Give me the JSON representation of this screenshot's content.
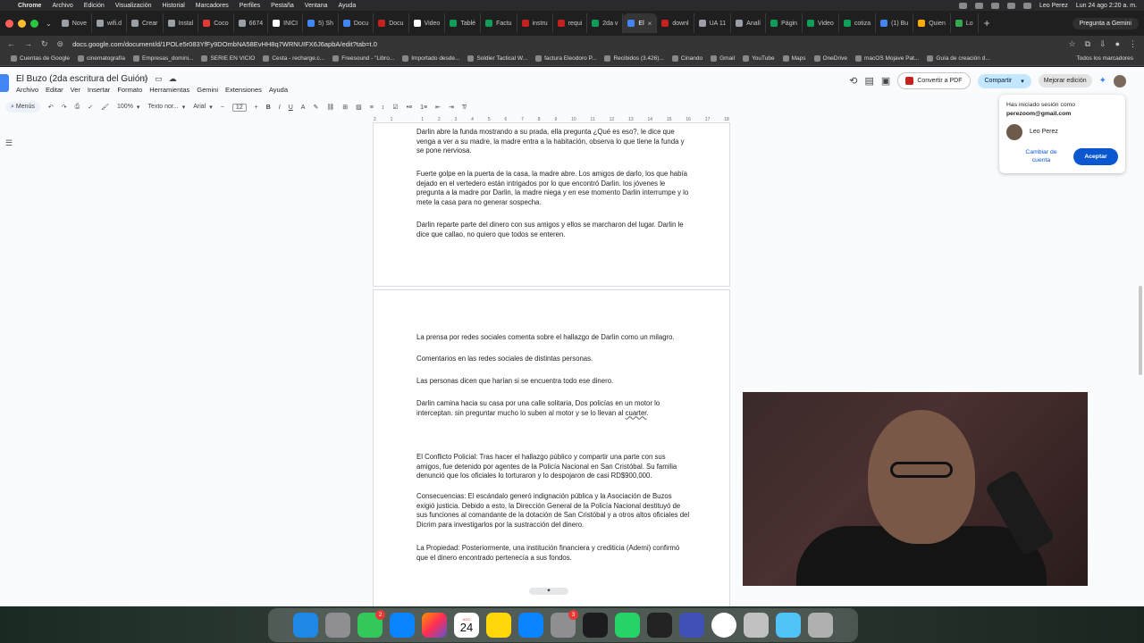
{
  "macos_menu": {
    "app": "Chrome",
    "items": [
      "Archivo",
      "Edición",
      "Visualización",
      "Historial",
      "Marcadores",
      "Perfiles",
      "Pestaña",
      "Ventana",
      "Ayuda"
    ],
    "user": "Leo Perez",
    "clock": "Lun 24 ago 2:20 a. m."
  },
  "tabs": [
    {
      "label": "Nove",
      "color": "#9aa0a6"
    },
    {
      "label": "wifi.d",
      "color": "#9aa0a6"
    },
    {
      "label": "Crear",
      "color": "#9aa0a6"
    },
    {
      "label": "Instal",
      "color": "#9aa0a6"
    },
    {
      "label": "Coco",
      "color": "#e53935"
    },
    {
      "label": "6674",
      "color": "#9aa0a6"
    },
    {
      "label": "INICI",
      "color": "#ffffff"
    },
    {
      "label": "5) Sh",
      "color": "#4285f4"
    },
    {
      "label": "Docu",
      "color": "#4285f4"
    },
    {
      "label": "Docu",
      "color": "#c5221f"
    },
    {
      "label": "Video",
      "color": "#ffffff"
    },
    {
      "label": "Tablé",
      "color": "#0f9d58"
    },
    {
      "label": "Factu",
      "color": "#0f9d58"
    },
    {
      "label": "instru",
      "color": "#c5221f"
    },
    {
      "label": "requi",
      "color": "#c5221f"
    },
    {
      "label": "2da v",
      "color": "#0f9d58"
    },
    {
      "label": "El",
      "color": "#4285f4",
      "active": true
    },
    {
      "label": "downl",
      "color": "#c5221f"
    },
    {
      "label": "UA 11",
      "color": "#9aa0a6"
    },
    {
      "label": "Analí",
      "color": "#9aa0a6"
    },
    {
      "label": "Págin",
      "color": "#0f9d58"
    },
    {
      "label": "Video",
      "color": "#0f9d58"
    },
    {
      "label": "cotiza",
      "color": "#0f9d58"
    },
    {
      "label": "(1) Bu",
      "color": "#4285f4"
    },
    {
      "label": "Quien",
      "color": "#f9ab00"
    },
    {
      "label": "Lo",
      "color": "#34a853"
    }
  ],
  "ask_gemini": "Pregunta a Gemini",
  "url": "docs.google.com/document/d/1POLe5r083YfFy9DOmbNA58EvHH8q7WRNUIFX6J6apbA/edit?tab=t.0",
  "bookmarks": [
    "Cuentas de Google",
    "cinematografía",
    "Empresas_domini...",
    "SERIE EN VICIO",
    "Cesta - recharge.c...",
    "Freesound - \"Libro...",
    "Importado desde...",
    "Soldier Tactical W...",
    "factura Eleodoro P...",
    "Recibidos (3.426)...",
    "Cinando",
    "Gmail",
    "YouTube",
    "Maps",
    "OneDrive",
    "macOS Mojave Pat...",
    "Guía de creación d..."
  ],
  "all_bookmarks": "Todos los marcadores",
  "doc": {
    "title": "El Buzo (2da escritura del Guión)",
    "menus": [
      "Archivo",
      "Editar",
      "Ver",
      "Insertar",
      "Formato",
      "Herramientas",
      "Gemini",
      "Extensiones",
      "Ayuda"
    ],
    "convert_pdf": "Convertir a PDF",
    "share": "Compartir",
    "improve": "Mejorar edición"
  },
  "toolbar": {
    "menus": "Menús",
    "zoom": "100%",
    "style": "Texto nor...",
    "font": "Arial",
    "size": "12"
  },
  "ruler_ticks": [
    "2",
    "1",
    "",
    "1",
    "2",
    "3",
    "4",
    "5",
    "6",
    "7",
    "8",
    "9",
    "10",
    "11",
    "12",
    "13",
    "14",
    "15",
    "16",
    "17",
    "18"
  ],
  "page1": [
    "Darlin abre la funda mostrando a su prada, ella pregunta ¿Qué es eso?, le dice que venga a ver a su madre, la madre entra a la habitación, observa lo que tiene la funda y se pone nerviosa.",
    "Fuerte golpe en la puerta de la casa, la madre abre. Los amigos de darlo, los que había dejado en el vertedero están intrigados por lo que encontró Darlin. los jóvenes le pregunta a la madre por Darlin, la madre niega y en ese momento Darlin interrumpe y lo mete la casa para no generar sospecha.",
    "Darlin reparte parte del dinero con sus amigos y ellos se marcharon del lugar. Darlin le dice que callao, no quiero que todos se enteren."
  ],
  "page2": {
    "p1": "La prensa por redes sociales comenta sobre el hallazgo de Darlin como un milagro.",
    "p2": "Comentarios en las redes sociales  de distintas personas.",
    "p3": "Las personas dicen que harían si se encuentra todo ese dinero.",
    "p4_a": "Darlin camina hacia su casa por una calle solitaria, Dos policías en un motor lo interceptan. sin preguntar mucho lo suben al motor y se lo llevan al ",
    "p4_b": "cuarter",
    "p4_c": ".",
    "p5": "El Conflicto Policial: Tras hacer el hallazgo público y compartir una parte con sus amigos, fue detenido por agentes de la Policía Nacional en San Cristóbal. Su familia denunció que los oficiales lo torturaron y lo despojaron de casi RD$900,000.",
    "p6": "Consecuencias: El escándalo generó indignación pública y la Asociación de Buzos exigió justicia. Debido a esto, la Dirección General de la Policía Nacional destituyó de sus funciones al comandante de la dotación de San Cristóbal y a otros altos oficiales del Dicrim para investigarlos por la sustracción del dinero.",
    "p7": "La Propiedad: Posteriormente, una institución financiera y crediticia (Ademi) confirmó que el dinero encontrado pertenecía a sus fondos."
  },
  "popup": {
    "signed_in_as": "Has iniciado sesión como",
    "email": "perezoom@gmail.com",
    "name": "Leo Perez",
    "switch": "Cambiar de cuenta",
    "accept": "Aceptar"
  },
  "dock": {
    "messages_badge": "2",
    "settings_badge": "3",
    "calendar_month": "AGO",
    "calendar_day": "24"
  }
}
